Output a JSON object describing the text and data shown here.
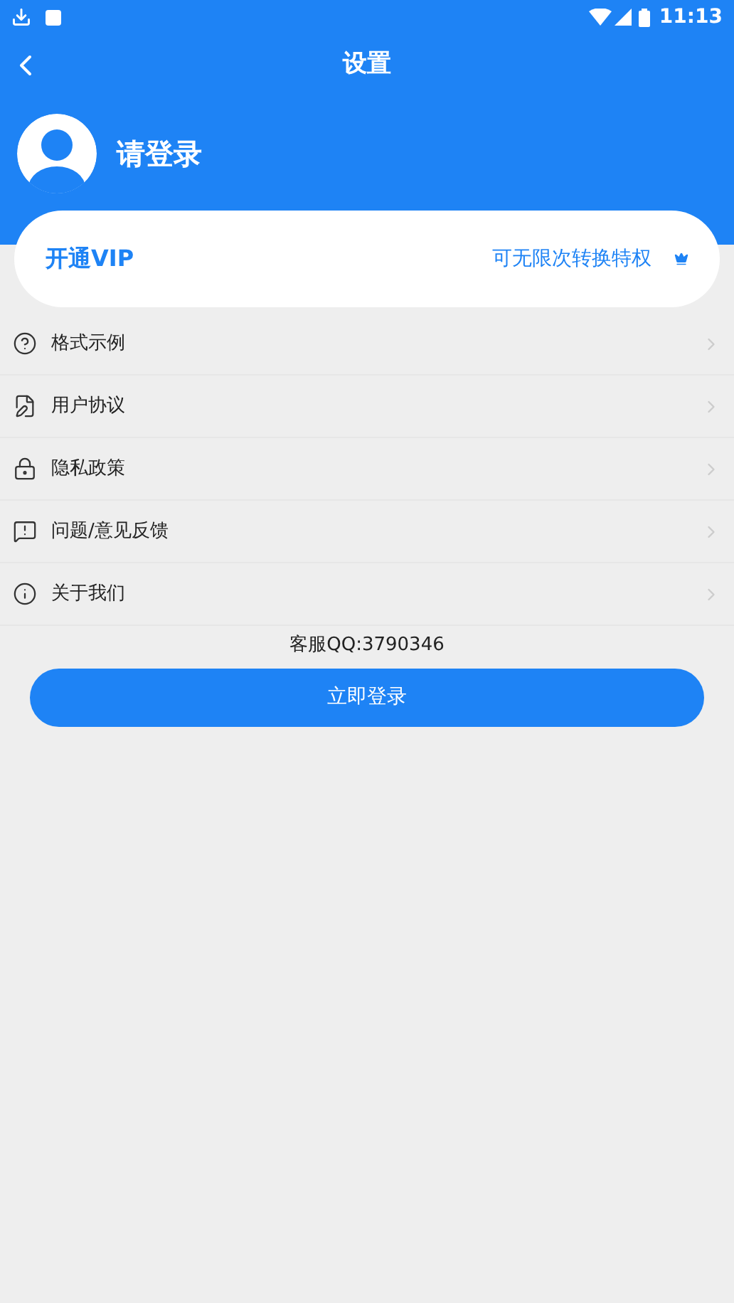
{
  "status_bar": {
    "time": "11:13"
  },
  "header": {
    "title": "设置"
  },
  "profile": {
    "name": "请登录"
  },
  "vip_card": {
    "title": "开通VIP",
    "subtitle": "可无限次转换特权"
  },
  "menu": [
    {
      "kind": "help",
      "label": "格式示例"
    },
    {
      "kind": "document",
      "label": "用户协议"
    },
    {
      "kind": "lock",
      "label": "隐私政策"
    },
    {
      "kind": "feedback",
      "label": "问题/意见反馈"
    },
    {
      "kind": "info",
      "label": "关于我们"
    }
  ],
  "support": "客服QQ:3790346",
  "login_button": "立即登录"
}
